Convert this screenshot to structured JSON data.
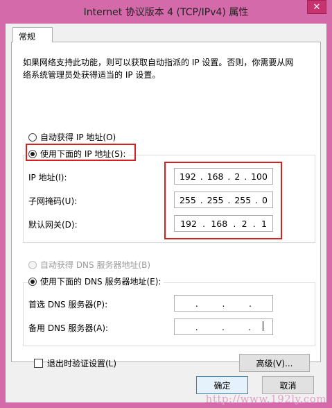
{
  "window": {
    "title": "Internet 协议版本 4 (TCP/IPv4) 属性",
    "close_glyph": "✕"
  },
  "tabs": [
    {
      "label": "常规"
    }
  ],
  "description": "如果网络支持此功能，则可以获取自动指派的 IP 设置。否则，你需要从网络系统管理员处获得适当的 IP 设置。",
  "ip_section": {
    "auto_label": "自动获得 IP 地址(O)",
    "manual_label": "使用下面的 IP 地址(S):",
    "selected": "manual",
    "fields": [
      {
        "label": "IP 地址(I):",
        "octets": [
          "192",
          "168",
          "2",
          "100"
        ]
      },
      {
        "label": "子网掩码(U):",
        "octets": [
          "255",
          "255",
          "255",
          "0"
        ]
      },
      {
        "label": "默认网关(D):",
        "octets": [
          "192",
          "168",
          "2",
          "1"
        ]
      }
    ]
  },
  "dns_section": {
    "auto_label": "自动获得 DNS 服务器地址(B)",
    "manual_label": "使用下面的 DNS 服务器地址(E):",
    "selected": "manual",
    "fields": [
      {
        "label": "首选 DNS 服务器(P):",
        "octets": [
          "",
          "",
          "",
          ""
        ]
      },
      {
        "label": "备用 DNS 服务器(A):",
        "octets": [
          "",
          "",
          "",
          ""
        ]
      }
    ]
  },
  "validate_checkbox": {
    "label": "退出时验证设置(L)",
    "checked": false
  },
  "advanced_button": "高级(V)...",
  "ok_button": "确定",
  "cancel_button": "取消",
  "watermark": "http://www.192ly.com",
  "colors": {
    "highlight": "#d42020",
    "title_bar": "#d56aab",
    "close_button": "#c7336f"
  }
}
